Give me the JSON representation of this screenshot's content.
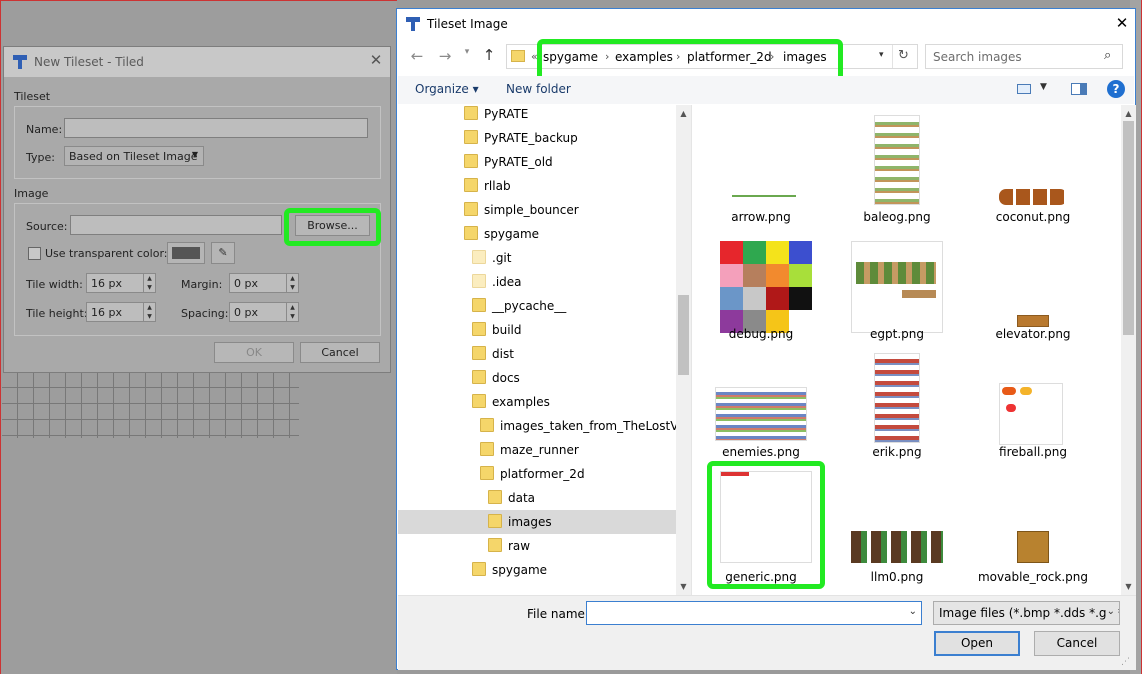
{
  "tileset_dialog": {
    "title": "New Tileset - Tiled",
    "tileset_section": "Tileset",
    "name_label": "Name:",
    "name_value": "",
    "type_label": "Type:",
    "type_value": "Based on Tileset Image",
    "image_section": "Image",
    "source_label": "Source:",
    "source_value": "",
    "browse_label": "Browse...",
    "transparent_label": "Use transparent color:",
    "tile_width_label": "Tile width:",
    "tile_width_value": "16 px",
    "tile_height_label": "Tile height:",
    "tile_height_value": "16 px",
    "margin_label": "Margin:",
    "margin_value": "0 px",
    "spacing_label": "Spacing:",
    "spacing_value": "0 px",
    "ok_label": "OK",
    "cancel_label": "Cancel"
  },
  "file_dialog": {
    "title": "Tileset Image",
    "breadcrumb": {
      "overflow": "«",
      "items": [
        "spygame",
        "examples",
        "platformer_2d",
        "images"
      ]
    },
    "search_placeholder": "Search images",
    "organize_label": "Organize ▾",
    "new_folder_label": "New folder",
    "tree": [
      "PyRATE",
      "PyRATE_backup",
      "PyRATE_old",
      "rllab",
      "simple_bouncer",
      "spygame",
      ".git",
      ".idea",
      "__pycache__",
      "build",
      "dist",
      "docs",
      "examples",
      "images_taken_from_TheLostVikings",
      "maze_runner",
      "platformer_2d",
      "data",
      "images",
      "raw",
      "spygame"
    ],
    "files": [
      "arrow.png",
      "baleog.png",
      "coconut.png",
      "debug.png",
      "egpt.png",
      "elevator.png",
      "enemies.png",
      "erik.png",
      "fireball.png",
      "generic.png",
      "llm0.png",
      "movable_rock.png"
    ],
    "file_name_label": "File name:",
    "file_name_value": "",
    "file_type_value": "Image files (*.bmp *.dds *.gif *.",
    "open_label": "Open",
    "cancel_label": "Cancel"
  },
  "colors": {
    "highlight": "#22ea22",
    "accent": "#3b7fd0"
  }
}
